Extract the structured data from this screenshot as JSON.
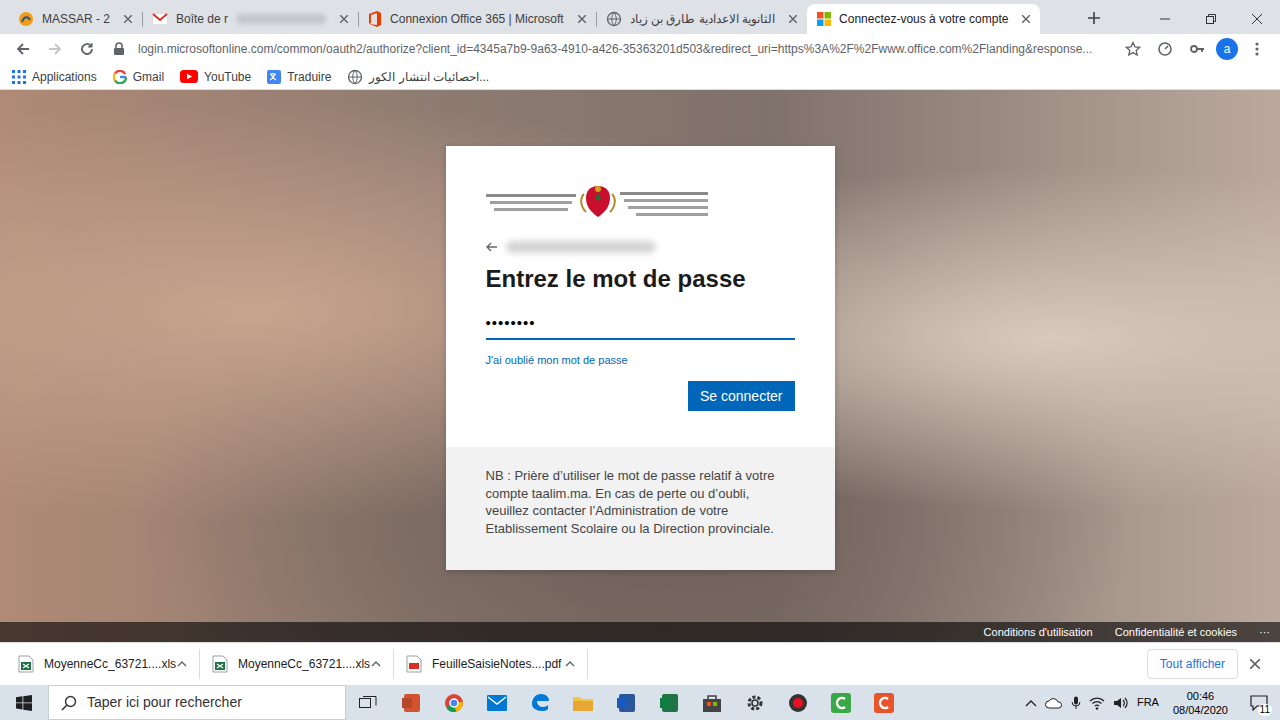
{
  "browser": {
    "tabs": [
      {
        "label": "MASSAR - 2",
        "selected": false,
        "kind": "massar"
      },
      {
        "label": "Boîte de r",
        "selected": false,
        "kind": "gmail"
      },
      {
        "label": "Connexion Office 365 | Microsoft",
        "selected": false,
        "kind": "office"
      },
      {
        "label": "الثانوية الاعدادية طارق بن زياد",
        "selected": false,
        "kind": "globe"
      },
      {
        "label": "Connectez-vous à votre compte",
        "selected": true,
        "kind": "microsoft"
      }
    ],
    "address": "login.microsoftonline.com/common/oauth2/authorize?client_id=4345a7b9-9a63-4910-a426-35363201d503&redirect_uri=https%3A%2F%2Fwww.office.com%2Flanding&response...",
    "profile": "a",
    "bookmarks": [
      {
        "label": "Applications",
        "kind": "apps"
      },
      {
        "label": "Gmail",
        "kind": "google"
      },
      {
        "label": "YouTube",
        "kind": "youtube"
      },
      {
        "label": "Traduire",
        "kind": "translate"
      },
      {
        "label": "احصائيات انتشار الكور...",
        "kind": "globe"
      }
    ]
  },
  "login": {
    "heading": "Entrez le mot de passe",
    "password": "••••••••",
    "forgot": "J'ai oublié mon mot de passe",
    "button": "Se connecter",
    "note": "NB : Prière d’utiliser le mot de passe relatif à votre compte taalim.ma. En cas de perte ou d’oubli, veuillez contacter l’Administration de votre Etablissement Scolaire ou la Direction provinciale."
  },
  "page_footer": [
    "Conditions d'utilisation",
    "Confidentialité et cookies",
    "···"
  ],
  "downloads": {
    "items": [
      {
        "name": "MoyenneCc_63721....xls",
        "kind": "xls"
      },
      {
        "name": "MoyenneCc_63721....xls",
        "kind": "xls"
      },
      {
        "name": "FeuilleSaisieNotes....pdf",
        "kind": "pdf"
      }
    ],
    "show_all": "Tout afficher"
  },
  "taskbar": {
    "search": "Taper ici pour rechercher",
    "language": "FRA",
    "time": "00:46",
    "date": "08/04/2020",
    "notifications": "11"
  }
}
